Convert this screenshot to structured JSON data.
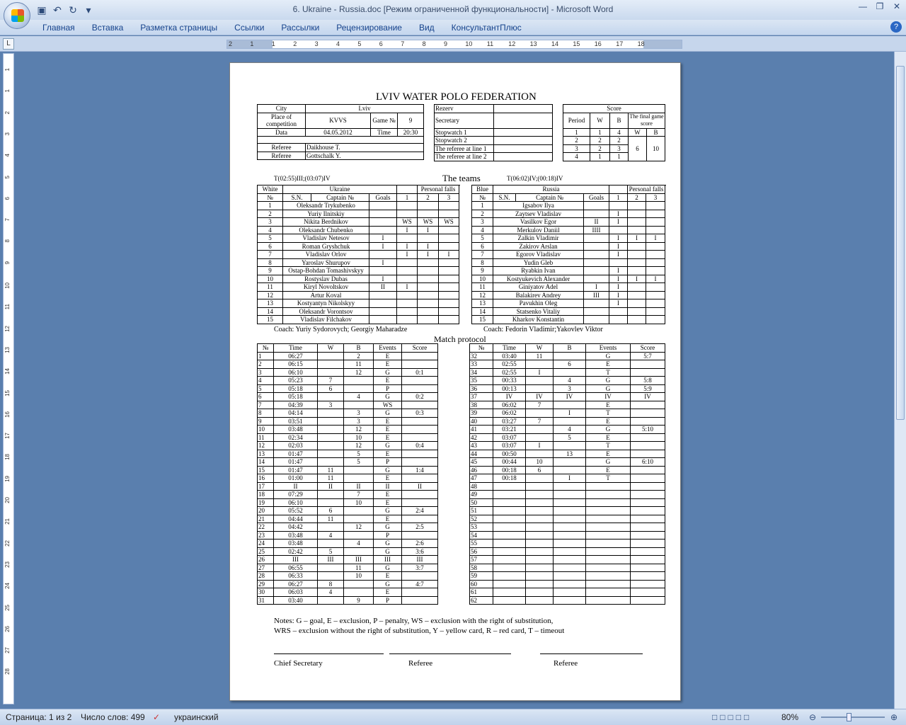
{
  "window": {
    "title": "6. Ukraine - Russia.doc [Режим ограниченной функциональности] - Microsoft Word"
  },
  "ribbon": {
    "tabs": [
      "Главная",
      "Вставка",
      "Разметка страницы",
      "Ссылки",
      "Рассылки",
      "Рецензирование",
      "Вид",
      "КонсультантПлюс"
    ]
  },
  "ruler": {
    "h_numbers": [
      "2",
      "1",
      "1",
      "2",
      "3",
      "4",
      "5",
      "6",
      "7",
      "8",
      "9",
      "10",
      "11",
      "12",
      "13",
      "14",
      "15",
      "16",
      "17",
      "18"
    ],
    "v_numbers": [
      "1",
      "1",
      "2",
      "3",
      "4",
      "5",
      "6",
      "7",
      "8",
      "9",
      "10",
      "11",
      "12",
      "13",
      "14",
      "15",
      "16",
      "17",
      "18",
      "19",
      "20",
      "21",
      "22",
      "23",
      "24",
      "25",
      "26",
      "27",
      "28"
    ]
  },
  "status": {
    "page": "Страница: 1 из 2",
    "words": "Число слов: 499",
    "lang": "украинский",
    "zoom": "80%"
  },
  "doc": {
    "title": "LVIV WATER POLO FEDERATION",
    "info": {
      "city_label": "City",
      "city": "Lviv",
      "place_label": "Place of competition",
      "place": "KVVS",
      "game_label": "Game №",
      "game": "9",
      "date_label": "Data",
      "date": "04.05.2012",
      "time_label": "Time",
      "time": "20:30",
      "referee_label": "Referee",
      "referee1": "Daikhouse T.",
      "referee2": "Gottschalk Y."
    },
    "secretary": {
      "rows": [
        "Rezerv",
        "Secretary",
        "Stopwatch 1",
        "Stopwatch 2",
        "The referee at line 1",
        "The referee at line 2"
      ]
    },
    "score": {
      "title": "Score",
      "period_label": "Period",
      "w": "W",
      "b": "B",
      "final_label": "The final game score",
      "rows": [
        [
          "1",
          "1",
          "4"
        ],
        [
          "2",
          "2",
          "2"
        ],
        [
          "3",
          "2",
          "3"
        ],
        [
          "4",
          "1",
          "1"
        ]
      ],
      "final_w": "6",
      "final_b": "10"
    },
    "teams_title": "The teams",
    "timeline_ua": "T(02:55)III;(03:07)IV",
    "timeline_ru": "T(06:02)IV;(00:18)IV",
    "ua": {
      "color": "White",
      "name": "Ukraine",
      "pf": "Personal falls",
      "h_no": "№",
      "h_sn": "S.N.",
      "h_cap": "Captain №",
      "h_goals": "Goals",
      "players": [
        [
          "1",
          "Oleksandr Trykubenko",
          "",
          "",
          "",
          ""
        ],
        [
          "2",
          "Yuriy Ilnitskiy",
          "",
          "",
          "",
          ""
        ],
        [
          "3",
          "Nikita Berdnikov",
          "",
          "WS",
          "WS",
          "WS"
        ],
        [
          "4",
          "Oleksandr Chubenko",
          "",
          "I",
          "I",
          ""
        ],
        [
          "5",
          "Vladislav Netesov",
          "I",
          "",
          "",
          ""
        ],
        [
          "6",
          "Roman Gryshchuk",
          "I",
          "I",
          "I",
          ""
        ],
        [
          "7",
          "Vladislav Orlov",
          "",
          "I",
          "I",
          "I"
        ],
        [
          "8",
          "Yaroslav Shurupov",
          "I",
          "",
          "",
          ""
        ],
        [
          "9",
          "Ostap-Bohdan Tomashivskyy",
          "",
          "",
          "",
          ""
        ],
        [
          "10",
          "Rostyslav Dubas",
          "I",
          "",
          "",
          ""
        ],
        [
          "11",
          "Kiryl Novoltskov",
          "II",
          "I",
          "",
          ""
        ],
        [
          "12",
          "Artur Koval",
          "",
          "",
          "",
          ""
        ],
        [
          "13",
          "Kostyantyn Nikolskyy",
          "",
          "",
          "",
          ""
        ],
        [
          "14",
          "Oleksandr Vorontsov",
          "",
          "",
          "",
          ""
        ],
        [
          "15",
          "Vladislav Filchakov",
          "",
          "",
          "",
          ""
        ]
      ],
      "coach": "Coach:  Yuriy Sydorovych; Georgiy Maharadze"
    },
    "ru": {
      "color": "Blue",
      "name": "Russia",
      "pf": "Personal falls",
      "h_no": "№",
      "h_sn": "S.N.",
      "h_cap": "Captain №",
      "h_goals": "Goals",
      "players": [
        [
          "1",
          "Igsabov Ilya",
          "",
          "",
          "",
          ""
        ],
        [
          "2",
          "Zaytsev Vladislav",
          "",
          "I",
          "",
          ""
        ],
        [
          "3",
          "Vasilkov Egor",
          "II",
          "I",
          "",
          ""
        ],
        [
          "4",
          "Merkulov Daniil",
          "IIII",
          "",
          "",
          ""
        ],
        [
          "5",
          "Zalkin Vladimir",
          "",
          "I",
          "I",
          "I"
        ],
        [
          "6",
          "Zakirov Arslan",
          "",
          "I",
          "",
          ""
        ],
        [
          "7",
          "Egorov Vladislav",
          "",
          "I",
          "",
          ""
        ],
        [
          "8",
          "Yudin Gleb",
          "",
          "",
          "",
          ""
        ],
        [
          "9",
          "Ryabkin Ivan",
          "",
          "I",
          "",
          ""
        ],
        [
          "10",
          "Kostyukevich Alexander",
          "",
          "I",
          "I",
          "I"
        ],
        [
          "11",
          "Giniyatov Adel",
          "I",
          "I",
          "",
          ""
        ],
        [
          "12",
          "Balakirev Andrey",
          "III",
          "I",
          "",
          ""
        ],
        [
          "13",
          "Pavukhin Oleg",
          "",
          "I",
          "",
          ""
        ],
        [
          "14",
          "Statsenko Vitaliy",
          "",
          "",
          "",
          ""
        ],
        [
          "15",
          "Kharkov Konstantin",
          "",
          "",
          "",
          ""
        ]
      ],
      "coach": "Coach: Fedorin Vladimir;Yakovlev Viktor"
    },
    "match_protocol": "Match protocol",
    "mp_headers": [
      "№",
      "Time",
      "W",
      "B",
      "Events",
      "Score"
    ],
    "mp_left": [
      [
        "1",
        "06:27",
        "",
        "2",
        "E",
        ""
      ],
      [
        "2",
        "06:15",
        "",
        "11",
        "E",
        ""
      ],
      [
        "3",
        "06:10",
        "",
        "12",
        "G",
        "0:1"
      ],
      [
        "4",
        "05:23",
        "7",
        "",
        "E",
        ""
      ],
      [
        "5",
        "05:18",
        "6",
        "",
        "P",
        ""
      ],
      [
        "6",
        "05:18",
        "",
        "4",
        "G",
        "0:2"
      ],
      [
        "7",
        "04:39",
        "3",
        "",
        "WS",
        ""
      ],
      [
        "8",
        "04:14",
        "",
        "3",
        "G",
        "0:3"
      ],
      [
        "9",
        "03:51",
        "",
        "3",
        "E",
        ""
      ],
      [
        "10",
        "03:48",
        "",
        "12",
        "E",
        ""
      ],
      [
        "11",
        "02:34",
        "",
        "10",
        "E",
        ""
      ],
      [
        "12",
        "02:03",
        "",
        "12",
        "G",
        "0:4"
      ],
      [
        "13",
        "01:47",
        "",
        "5",
        "E",
        ""
      ],
      [
        "14",
        "01:47",
        "",
        "5",
        "P",
        ""
      ],
      [
        "15",
        "01:47",
        "11",
        "",
        "G",
        "1:4"
      ],
      [
        "16",
        "01:00",
        "11",
        "",
        "E",
        ""
      ],
      [
        "17",
        "II",
        "II",
        "II",
        "II",
        "II"
      ],
      [
        "18",
        "07:29",
        "",
        "7",
        "E",
        ""
      ],
      [
        "19",
        "06:10",
        "",
        "10",
        "E",
        ""
      ],
      [
        "20",
        "05:52",
        "6",
        "",
        "G",
        "2:4"
      ],
      [
        "21",
        "04:44",
        "11",
        "",
        "E",
        ""
      ],
      [
        "22",
        "04:42",
        "",
        "12",
        "G",
        "2:5"
      ],
      [
        "23",
        "03:48",
        "4",
        "",
        "P",
        ""
      ],
      [
        "24",
        "03:48",
        "",
        "4",
        "G",
        "2:6"
      ],
      [
        "25",
        "02:42",
        "5",
        "",
        "G",
        "3:6"
      ],
      [
        "26",
        "III",
        "III",
        "III",
        "III",
        "III"
      ],
      [
        "27",
        "06:55",
        "",
        "11",
        "G",
        "3:7"
      ],
      [
        "28",
        "06:33",
        "",
        "10",
        "E",
        ""
      ],
      [
        "29",
        "06:27",
        "8",
        "",
        "G",
        "4:7"
      ],
      [
        "30",
        "06:03",
        "4",
        "",
        "E",
        ""
      ],
      [
        "31",
        "03:40",
        "",
        "9",
        "P",
        ""
      ]
    ],
    "mp_right": [
      [
        "32",
        "03:40",
        "11",
        "",
        "G",
        "5:7"
      ],
      [
        "33",
        "02:55",
        "",
        "6",
        "E",
        ""
      ],
      [
        "34",
        "02:55",
        "I",
        "",
        "T",
        ""
      ],
      [
        "35",
        "00:33",
        "",
        "4",
        "G",
        "5:8"
      ],
      [
        "36",
        "00:13",
        "",
        "3",
        "G",
        "5:9"
      ],
      [
        "37",
        "IV",
        "IV",
        "IV",
        "IV",
        "IV"
      ],
      [
        "38",
        "06:02",
        "7",
        "",
        "E",
        ""
      ],
      [
        "39",
        "06:02",
        "",
        "I",
        "T",
        ""
      ],
      [
        "40",
        "03:27",
        "7",
        "",
        "E",
        ""
      ],
      [
        "41",
        "03:21",
        "",
        "4",
        "G",
        "5:10"
      ],
      [
        "42",
        "03:07",
        "",
        "5",
        "E",
        ""
      ],
      [
        "43",
        "03:07",
        "I",
        "",
        "T",
        ""
      ],
      [
        "44",
        "00:50",
        "",
        "13",
        "E",
        ""
      ],
      [
        "45",
        "00:44",
        "10",
        "",
        "G",
        "6:10"
      ],
      [
        "46",
        "00:18",
        "6",
        "",
        "E",
        ""
      ],
      [
        "47",
        "00:18",
        "",
        "I",
        "T",
        ""
      ],
      [
        "48",
        "",
        "",
        "",
        "",
        ""
      ],
      [
        "49",
        "",
        "",
        "",
        "",
        ""
      ],
      [
        "50",
        "",
        "",
        "",
        "",
        ""
      ],
      [
        "51",
        "",
        "",
        "",
        "",
        ""
      ],
      [
        "52",
        "",
        "",
        "",
        "",
        ""
      ],
      [
        "53",
        "",
        "",
        "",
        "",
        ""
      ],
      [
        "54",
        "",
        "",
        "",
        "",
        ""
      ],
      [
        "55",
        "",
        "",
        "",
        "",
        ""
      ],
      [
        "56",
        "",
        "",
        "",
        "",
        ""
      ],
      [
        "57",
        "",
        "",
        "",
        "",
        ""
      ],
      [
        "58",
        "",
        "",
        "",
        "",
        ""
      ],
      [
        "59",
        "",
        "",
        "",
        "",
        ""
      ],
      [
        "60",
        "",
        "",
        "",
        "",
        ""
      ],
      [
        "61",
        "",
        "",
        "",
        "",
        ""
      ],
      [
        "62",
        "",
        "",
        "",
        "",
        ""
      ]
    ],
    "notes1": "Notes: G – goal, E – exclusion, P – penalty, WS – exclusion with the right of substitution,",
    "notes2": "WRS – exclusion without the right of substitution, Y – yellow card,  R – red card, T – timeout",
    "sig1": "Chief Secretary",
    "sig2": "Referee",
    "sig3": "Referee"
  }
}
